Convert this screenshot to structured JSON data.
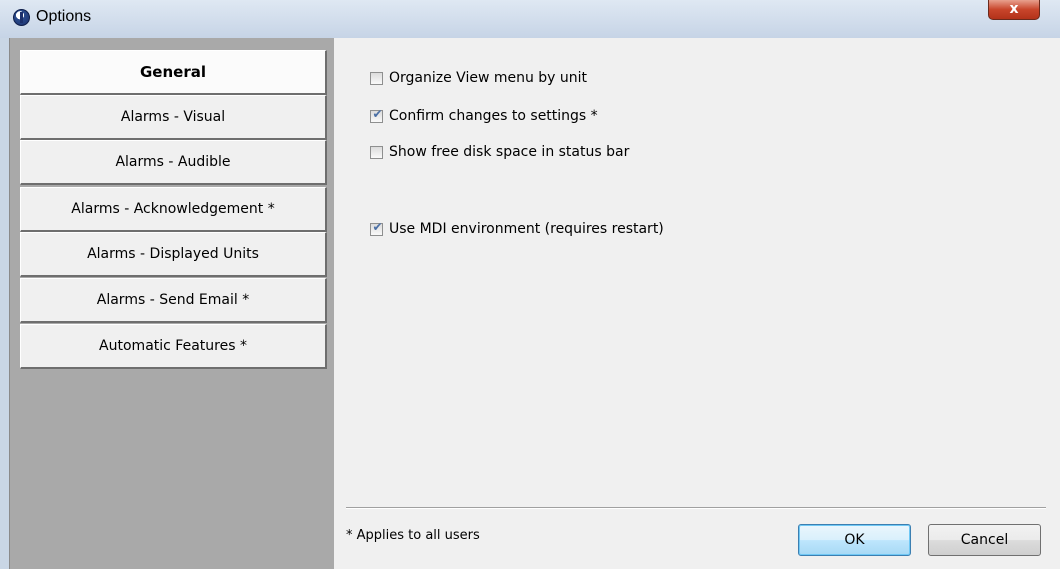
{
  "window": {
    "title": "Options",
    "close_label": "x"
  },
  "sidebar": {
    "items": [
      {
        "label": "General",
        "active": true
      },
      {
        "label": "Alarms - Visual",
        "active": false
      },
      {
        "label": "Alarms - Audible",
        "active": false
      },
      {
        "label": "Alarms - Acknowledgement *",
        "active": false
      },
      {
        "label": "Alarms - Displayed Units",
        "active": false
      },
      {
        "label": "Alarms - Send Email *",
        "active": false
      },
      {
        "label": "Automatic Features *",
        "active": false
      }
    ]
  },
  "options": [
    {
      "label": "Organize View menu by unit",
      "checked": false
    },
    {
      "label": "Confirm changes to settings *",
      "checked": true
    },
    {
      "label": "Show free disk space in status bar",
      "checked": false
    },
    {
      "label": "Use MDI environment (requires restart)",
      "checked": true
    }
  ],
  "footer": {
    "note": "* Applies to all users",
    "ok_label": "OK",
    "cancel_label": "Cancel"
  },
  "colors": {
    "sidebar_bg": "#a9a9a9",
    "content_bg": "#f0f0f0",
    "titlebar_bg": "#c9d6e5",
    "close_button": "#c8452b",
    "checkmark": "#4a6fa5"
  },
  "icons": {
    "app": "options-app-icon",
    "check": "checkmark-icon",
    "close": "close-icon"
  }
}
